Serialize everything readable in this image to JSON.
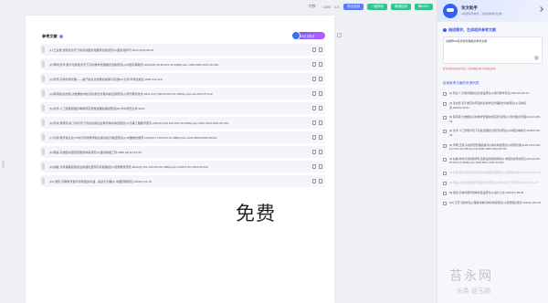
{
  "toolbar": {
    "word_count_label": "字数：",
    "word_count": "1000",
    "page_info": "1/1",
    "buttons": [
      {
        "label": "导出全部",
        "color": "#5b7cff"
      },
      {
        "label": "一键排版",
        "color": "#34c38f"
      },
      {
        "label": "降重检测",
        "color": "#34c38f"
      },
      {
        "label": "降AIGC",
        "color": "#34c38f"
      }
    ]
  },
  "document": {
    "section_title": "参考文献",
    "assistant_pill": "AI论文助手",
    "watermark_text": "免费",
    "references": [
      "[1] 王文君.智能化背景下的高校图书馆服务创新研究[J].图书馆学刊,2023,45(3):56-61.",
      "[2] 李明,张华.数字化转型背景下高校教学管理模式创新研究[J].中国高等教育,2022(18):45-48.DOI:10.3969/j.issn.1000-0000.2022.18.010.",
      "[3] 张伟.高校科研管理——基于信息化视角的探索与实践[M].北京:科学出版社,2022:112-118.",
      "[4] 陈晓丽,赵志刚.大数据技术在高校学生管理中的应用研究[J].现代教育技术,2021,31(7):88-94.DOI:10.13811/j.cnki.eer.2021.07.012.",
      "[5] 刘洋.人工智能赋能高等教育高质量发展的路径研究[D].华中师范大学,2023.",
      "[6] 周涛,吴晓燕.新工科背景下高校创新创业教育体系构建研究[J].高等工程教育研究,2021(5):120-126.DOI:10.3969/j.issn.1001-4233.2021.05.019.",
      "[7] 孙丽.教育信息化2.0时代高校教师信息素养提升路径研究[J].中国电化教育,2022(9):77-84.DOI:10.3969/j.issn.1006-9860.2022.09.011.",
      "[8] 黄磊.高校图书馆智慧服务体系研究[J].图书情报工作,2020,64(12):23-30.",
      "[9] 赵敏.高校课程思政建设的理论逻辑与实践路径[J].思想教育研究,2021(3):101-106.DOI:10.3969/j.issn.1002-5707.2021.03.018.",
      "[10] 郑凯.高等教育数字化转型的内涵、挑战与对策[J].中国高教研究,2023(2):12-19."
    ]
  },
  "panel": {
    "name": "论文助手",
    "subtitle": "AI智能写作助手，为您提供参考文献",
    "step_title": "描述需求，生成相关参考文献",
    "request_text": "请推荐30篇高校管理相关参考文献",
    "hint": "参考文献内容由AI生成，请仔细核对参考文献后使用",
    "sources_title": "检索参考文献的来源列表",
    "sources": [
      {
        "text": "[1] 张立人.高校管理信息化建设研究[J].教育教学论坛,2021(15):35-37.",
        "dim": false
      },
      {
        "text": "[2] 吴文君.基于数字化转型的高校学生管理模式创新研究[J].高教探索,2022(6):45-51.",
        "dim": false
      },
      {
        "text": "[3] 陈晓丽.大数据在高校教学管理中的应用与研究[J].现代教育管理,2021(4):88-92.",
        "dim": false
      },
      {
        "text": "[4] 刘洋.人工智能背景下高校治理能力现代化研究[J].中国高等教育,2023(5):30-33.",
        "dim": false
      },
      {
        "text": "[5] 李明,王丽.高校科研管理绩效评价体系构建研究[J].科研管理,2020,41(8):120-127.DOI:10.19571/j.cnki.1000-2995.2020.08.013.",
        "dim": false
      },
      {
        "text": "[6] 赵敏.新时代高校教师队伍建设的路径探析[J].中国高校师资研究,2021(2):56-60.DOI:10.3969/j.issn.1003-5621.2021.02.009.",
        "dim": false
      },
      {
        "text": "[7] 孙丽,周涛.智慧校园建设中的数据治理研究[J].中国电化教育,2022(10):66-72.",
        "dim": true
      },
      {
        "text": "[8] 黄磊.高校图书馆数字化服务创新研究[J].图书馆工作与研究,2021(6):41-45.",
        "dim": true
      },
      {
        "text": "[9] 郑凯.高校内部控制体系建设研究[J].会计之友,2022(12):88-93.",
        "dim": false
      },
      {
        "text": "[10] 王芳.高校学生心理健康教育体系构建研究[J].思想理论教育,2023(1):99-104.",
        "dim": false
      }
    ]
  },
  "footer_watermark": {
    "brand": "苔永网",
    "sub": "头条 @玉锡"
  }
}
